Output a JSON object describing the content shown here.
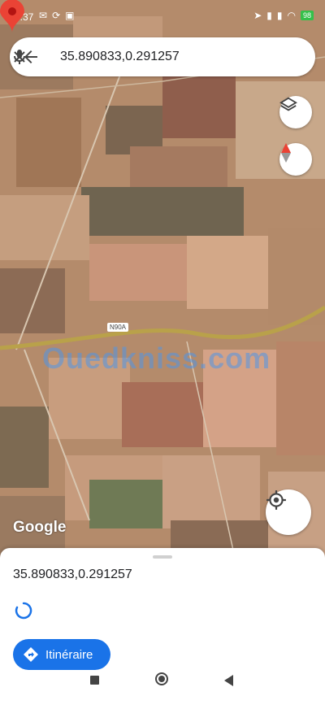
{
  "status_bar": {
    "time": "8:37",
    "battery": "98"
  },
  "search": {
    "query": "35.890833,0.291257"
  },
  "map": {
    "road_label": "N90A",
    "attribution": "Google",
    "watermark": "Ouedkniss.com"
  },
  "sheet": {
    "coordinates": "35.890833,0.291257",
    "directions_label": "Itinéraire"
  },
  "colors": {
    "accent": "#1a73e8",
    "pin": "#ea4335",
    "road": "#b9a14a"
  }
}
